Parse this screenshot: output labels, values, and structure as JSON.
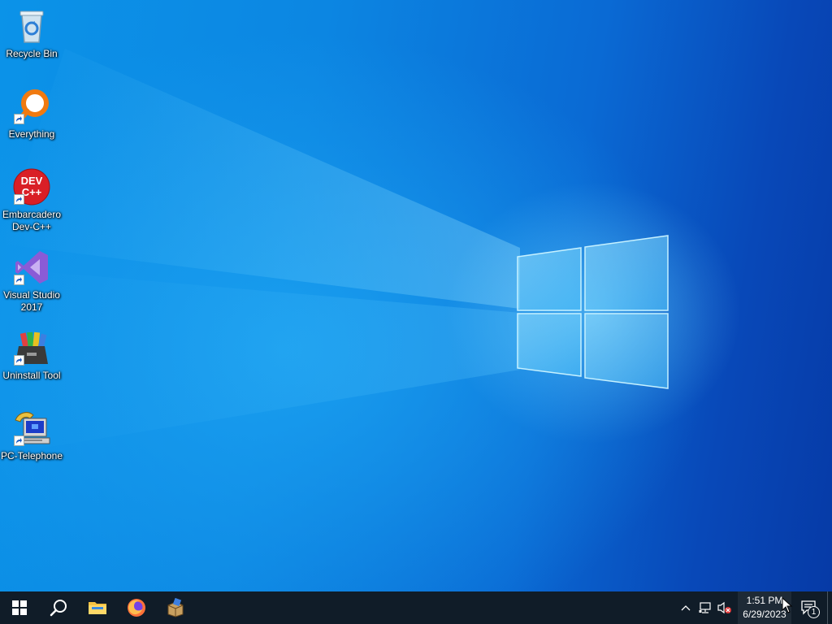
{
  "desktop": {
    "icons": [
      {
        "label": "Recycle Bin",
        "icon": "recycle-bin-icon"
      },
      {
        "label": "Everything",
        "icon": "everything-search-icon"
      },
      {
        "label": "Embarcadero Dev-C++",
        "icon": "devcpp-icon",
        "badge": "DEV C++"
      },
      {
        "label": "Visual Studio 2017",
        "icon": "visual-studio-icon"
      },
      {
        "label": "Uninstall Tool",
        "icon": "uninstall-tool-icon"
      },
      {
        "label": "PC-Telephone",
        "icon": "pc-telephone-icon"
      }
    ]
  },
  "taskbar": {
    "buttons": [
      {
        "name": "start",
        "icon": "windows-logo-icon"
      },
      {
        "name": "search",
        "icon": "search-icon"
      },
      {
        "name": "file-explorer",
        "icon": "folder-icon"
      },
      {
        "name": "firefox",
        "icon": "firefox-icon"
      },
      {
        "name": "installer",
        "icon": "package-icon"
      }
    ],
    "tray": {
      "icons": [
        "chevron-up-icon",
        "network-icon",
        "volume-muted-icon"
      ],
      "time": "1:51 PM",
      "date": "6/29/2023",
      "notification_count": "1"
    }
  },
  "colors": {
    "taskbar": "#101c28",
    "wallpaper_accent": "#0a6fd6"
  }
}
